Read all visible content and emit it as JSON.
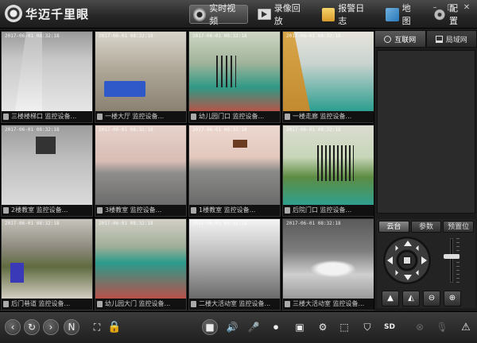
{
  "app": {
    "title": "华迈千里眼"
  },
  "nav": [
    {
      "label": "实时视频",
      "icon": "live-video-icon",
      "active": true
    },
    {
      "label": "录像回放",
      "icon": "playback-icon",
      "active": false
    },
    {
      "label": "报警日志",
      "icon": "alarm-log-icon",
      "active": false
    },
    {
      "label": "地图",
      "icon": "map-icon",
      "active": false
    },
    {
      "label": "配置",
      "icon": "settings-icon",
      "active": false
    }
  ],
  "window_buttons": {
    "minimize": "–",
    "maximize": "□",
    "close": "✕"
  },
  "cameras": [
    {
      "timestamp": "2017-06-01 08:32:18",
      "name": "三楼楼梯口  监控设备..."
    },
    {
      "timestamp": "2017-06-01 08:32:18",
      "name": "一楼大厅  监控设备..."
    },
    {
      "timestamp": "2017-06-01 08:32:18",
      "name": "幼儿园门口  监控设备..."
    },
    {
      "timestamp": "2017-06-01 08:32:18",
      "name": "一楼走廊  监控设备..."
    },
    {
      "timestamp": "2017-06-01 08:32:18",
      "name": "2楼教室  监控设备..."
    },
    {
      "timestamp": "2017-06-01 08:32:18",
      "name": "3楼教室  监控设备..."
    },
    {
      "timestamp": "2017-06-01 08:32:18",
      "name": "1楼教室  监控设备..."
    },
    {
      "timestamp": "2017-06-01 08:32:18",
      "name": "后院门口  监控设备..."
    },
    {
      "timestamp": "2017-06-01 08:32:18",
      "name": "后门巷道  监控设备..."
    },
    {
      "timestamp": "2017-06-01 08:32:18",
      "name": "幼儿园大门  监控设备..."
    },
    {
      "timestamp": "2017-06-01 08:32:18",
      "name": "二楼大活动室  监控设备..."
    },
    {
      "timestamp": "2017-06-01 08:32:18",
      "name": "三楼大活动室  监控设备..."
    }
  ],
  "network_tabs": [
    {
      "label": "互联网",
      "icon": "globe-icon",
      "active": true
    },
    {
      "label": "局域网",
      "icon": "lan-icon",
      "active": false
    }
  ],
  "ptz": {
    "tabs": [
      {
        "label": "云台",
        "active": true
      },
      {
        "label": "参数",
        "active": false
      },
      {
        "label": "预置位",
        "active": false
      }
    ]
  },
  "toolbar": {
    "number_button": "N",
    "sd_label": "SD"
  }
}
